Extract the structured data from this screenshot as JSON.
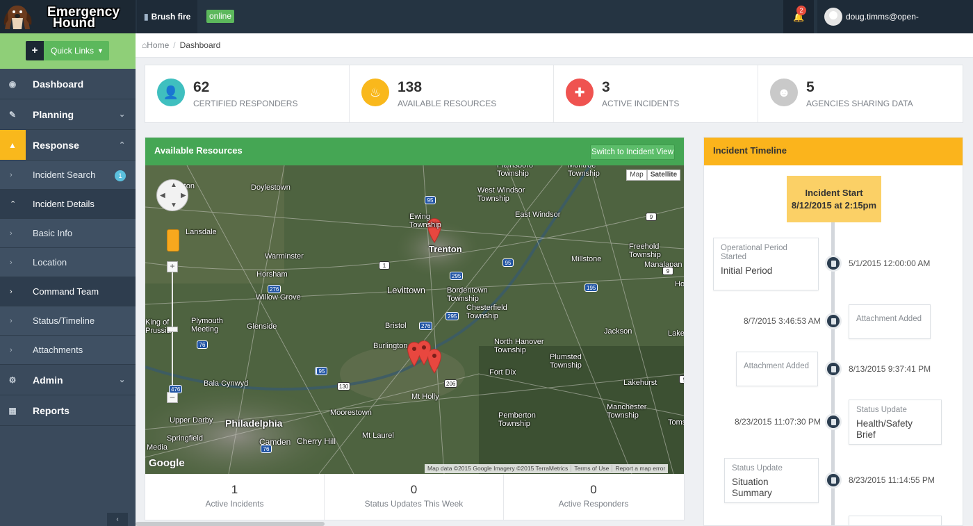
{
  "app": {
    "logo_line1": "Emergency",
    "logo_line2": "Hound",
    "incident_name": "Brush fire",
    "status_badge": "online"
  },
  "header": {
    "notification_count": "2",
    "user_email": "doug.timms@open-environment.org"
  },
  "sidebar": {
    "quick_links": "Quick Links",
    "items": [
      {
        "label": "Dashboard",
        "icon": "dashboard-icon"
      },
      {
        "label": "Planning",
        "icon": "edit-icon"
      },
      {
        "label": "Response",
        "icon": "megaphone-icon"
      },
      {
        "label": "Incident Search",
        "badge": "1"
      },
      {
        "label": "Incident Details"
      },
      {
        "label": "Basic Info"
      },
      {
        "label": "Location"
      },
      {
        "label": "Command Team"
      },
      {
        "label": "Status/Timeline"
      },
      {
        "label": "Attachments"
      },
      {
        "label": "Admin",
        "icon": "gear-icon"
      },
      {
        "label": "Reports",
        "icon": "document-icon"
      }
    ]
  },
  "breadcrumb": {
    "home": "Home",
    "current": "Dashboard"
  },
  "stats": [
    {
      "value": "62",
      "caption": "CERTIFIED RESPONDERS",
      "color": "#3fbfbf"
    },
    {
      "value": "138",
      "caption": "AVAILABLE RESOURCES",
      "color": "#f9b81c"
    },
    {
      "value": "3",
      "caption": "ACTIVE INCIDENTS",
      "color": "#ef5350"
    },
    {
      "value": "5",
      "caption": "AGENCIES SHARING DATA",
      "color": "#c9c9c9"
    }
  ],
  "resources": {
    "title": "Available Resources",
    "switch_label": "Switch to Incident View",
    "map_toggle": [
      "Map",
      "Satellite"
    ],
    "map_labels": [
      "Doylestown",
      "Lansdale",
      "Warminster",
      "Horsham",
      "Willow Grove",
      "Plymouth Meeting",
      "Glenside",
      "King of Prussia",
      "Bala Cynwyd",
      "Upper Darby",
      "Philadelphia",
      "Springfield",
      "Media",
      "Camden",
      "Cherry Hill",
      "Moorestown",
      "Mt Laurel",
      "Mt Holly",
      "Burlington",
      "Bristol",
      "Levittown",
      "Ewing Township",
      "Trenton",
      "Bordentown Township",
      "Chesterfield Township",
      "Plainsboro Township",
      "West Windsor Township",
      "East Windsor",
      "Montroe Township",
      "Freehold Township",
      "Millstone",
      "Manalapan",
      "North Hanover Township",
      "Plumsted Township",
      "Fort Dix",
      "Jackson",
      "Lakehurst",
      "Manchester Township",
      "Pemberton Township",
      "Lakewood",
      "Toms",
      "Ho",
      "rton"
    ],
    "map_attribution": [
      "Map data ©2015 Google Imagery ©2015 TerraMetrics",
      "Terms of Use",
      "Report a map error"
    ],
    "google_logo": "Google",
    "footer": [
      {
        "value": "1",
        "caption": "Active Incidents"
      },
      {
        "value": "0",
        "caption": "Status Updates This Week"
      },
      {
        "value": "0",
        "caption": "Active Responders"
      }
    ]
  },
  "timeline": {
    "title": "Incident Timeline",
    "start_title": "Incident Start",
    "start_date": "8/12/2015 at 2:15pm",
    "entries": [
      {
        "kind": "Operational Period Started",
        "value": "Initial Period",
        "date": "5/1/2015 12:00:00 AM"
      },
      {
        "kind": "Attachment Added",
        "value": "",
        "date": "8/7/2015 3:46:53 AM"
      },
      {
        "kind": "Attachment Added",
        "value": "",
        "date": "8/13/2015 9:37:41 PM"
      },
      {
        "kind": "Status Update",
        "value": "Health/Safety Brief",
        "date": "8/23/2015 11:07:30 PM"
      },
      {
        "kind": "Status Update",
        "value": "Situation Summary",
        "date": "8/23/2015 11:14:55 PM"
      }
    ]
  },
  "map_route_shields": [
    "95",
    "95",
    "1",
    "295",
    "95",
    "195",
    "276",
    "276",
    "295",
    "76",
    "95",
    "130",
    "206",
    "476",
    "76",
    "9",
    "9",
    "9"
  ]
}
